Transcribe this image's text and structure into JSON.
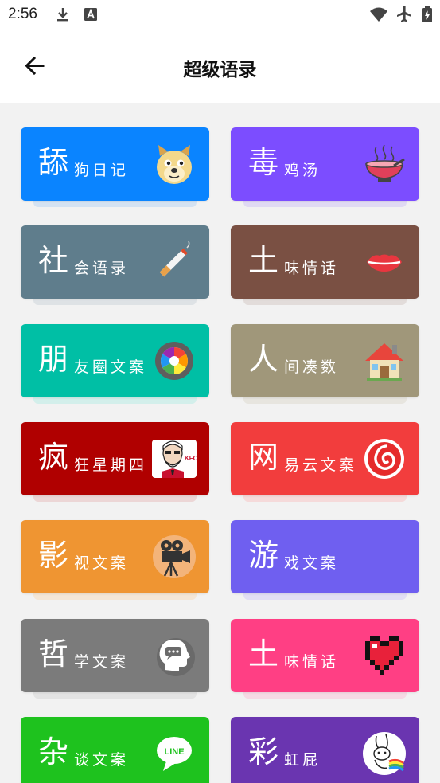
{
  "status_bar": {
    "time": "2:56"
  },
  "header": {
    "title": "超级语录"
  },
  "cards": [
    {
      "big": "舔",
      "small": "狗日记",
      "color": "#0a84ff",
      "shadow": "#bcd6f2",
      "icon": "doge-face-icon"
    },
    {
      "big": "毒",
      "small": "鸡汤",
      "color": "#7c4dff",
      "shadow": "#d2c6f4",
      "icon": "soup-bowl-icon"
    },
    {
      "big": "社",
      "small": "会语录",
      "color": "#5f7d8c",
      "shadow": "#cdd6db",
      "icon": "cigarette-icon"
    },
    {
      "big": "土",
      "small": "味情话",
      "color": "#7a5043",
      "shadow": "#d6cbc7",
      "icon": "lips-icon"
    },
    {
      "big": "朋",
      "small": "友圈文案",
      "color": "#00bfa5",
      "shadow": "#b9ece5",
      "icon": "camera-aperture-icon"
    },
    {
      "big": "人",
      "small": "间凑数",
      "color": "#a0977a",
      "shadow": "#dfdbd0",
      "icon": "house-icon"
    },
    {
      "big": "疯",
      "small": "狂星期四",
      "color": "#b00000",
      "shadow": "#e8c0c0",
      "icon": "kfc-colonel-icon"
    },
    {
      "big": "网",
      "small": "易云文案",
      "color": "#f23d3d",
      "shadow": "#f7c6c6",
      "icon": "netease-music-icon"
    },
    {
      "big": "影",
      "small": "视文案",
      "color": "#ef9532",
      "shadow": "#f6dcbd",
      "icon": "movie-camera-icon"
    },
    {
      "big": "游",
      "small": "戏文案",
      "color": "#6f5ff0",
      "shadow": "#d3cdf6",
      "icon": ""
    },
    {
      "big": "哲",
      "small": "学文案",
      "color": "#7b7b7b",
      "shadow": "#d7d7d7",
      "icon": "head-thought-icon"
    },
    {
      "big": "土",
      "small": "味情话",
      "color": "#ff3f84",
      "shadow": "#f9c4d8",
      "icon": "pixel-heart-icon"
    },
    {
      "big": "杂",
      "small": "谈文案",
      "color": "#1ec21e",
      "shadow": "#bdeabd",
      "icon": "line-app-icon"
    },
    {
      "big": "彩",
      "small": "虹屁",
      "color": "#6a35b0",
      "shadow": "#d6c7e8",
      "icon": "rainbow-bunny-icon"
    }
  ]
}
